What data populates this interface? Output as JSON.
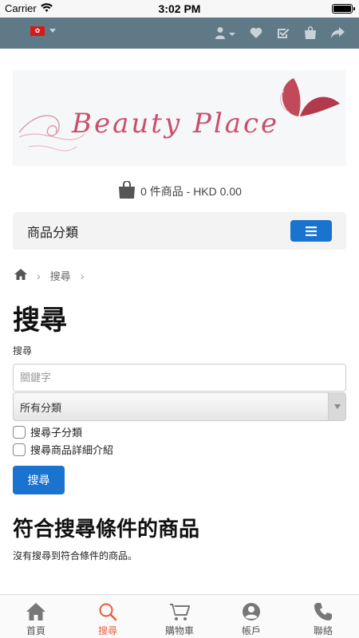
{
  "status_bar": {
    "carrier": "Carrier",
    "time": "3:02 PM"
  },
  "topbar": {
    "flag_icon": "hong-kong-flag-icon",
    "icons": [
      "user-icon",
      "heart-icon",
      "checkbox-icon",
      "bag-icon",
      "share-icon"
    ]
  },
  "logo": {
    "text": "Beauty Place"
  },
  "cart": {
    "summary": "0 件商品 - HKD 0.00"
  },
  "category_bar": {
    "label": "商品分類"
  },
  "breadcrumb": {
    "current": "搜尋"
  },
  "search_page": {
    "title": "搜尋",
    "field_label": "搜尋",
    "keyword_placeholder": "關鍵字",
    "category_selected": "所有分類",
    "checkbox_subcategory": "搜尋子分類",
    "checkbox_description": "搜尋商品詳細介紹",
    "search_button": "搜尋",
    "results_heading": "符合搜尋條件的商品",
    "no_results": "沒有搜尋到符合條件的商品。"
  },
  "tabbar": {
    "tabs": [
      {
        "label": "首頁",
        "icon": "home-icon",
        "active": false
      },
      {
        "label": "搜尋",
        "icon": "search-icon",
        "active": true
      },
      {
        "label": "購物車",
        "icon": "cart-icon",
        "active": false
      },
      {
        "label": "帳戶",
        "icon": "account-icon",
        "active": false
      },
      {
        "label": "聯絡",
        "icon": "phone-icon",
        "active": false
      }
    ]
  },
  "colors": {
    "topbar": "#5f7987",
    "primary": "#1a73cf",
    "active_tab": "#e95c3a",
    "logo_pink": "#c94f6d"
  }
}
